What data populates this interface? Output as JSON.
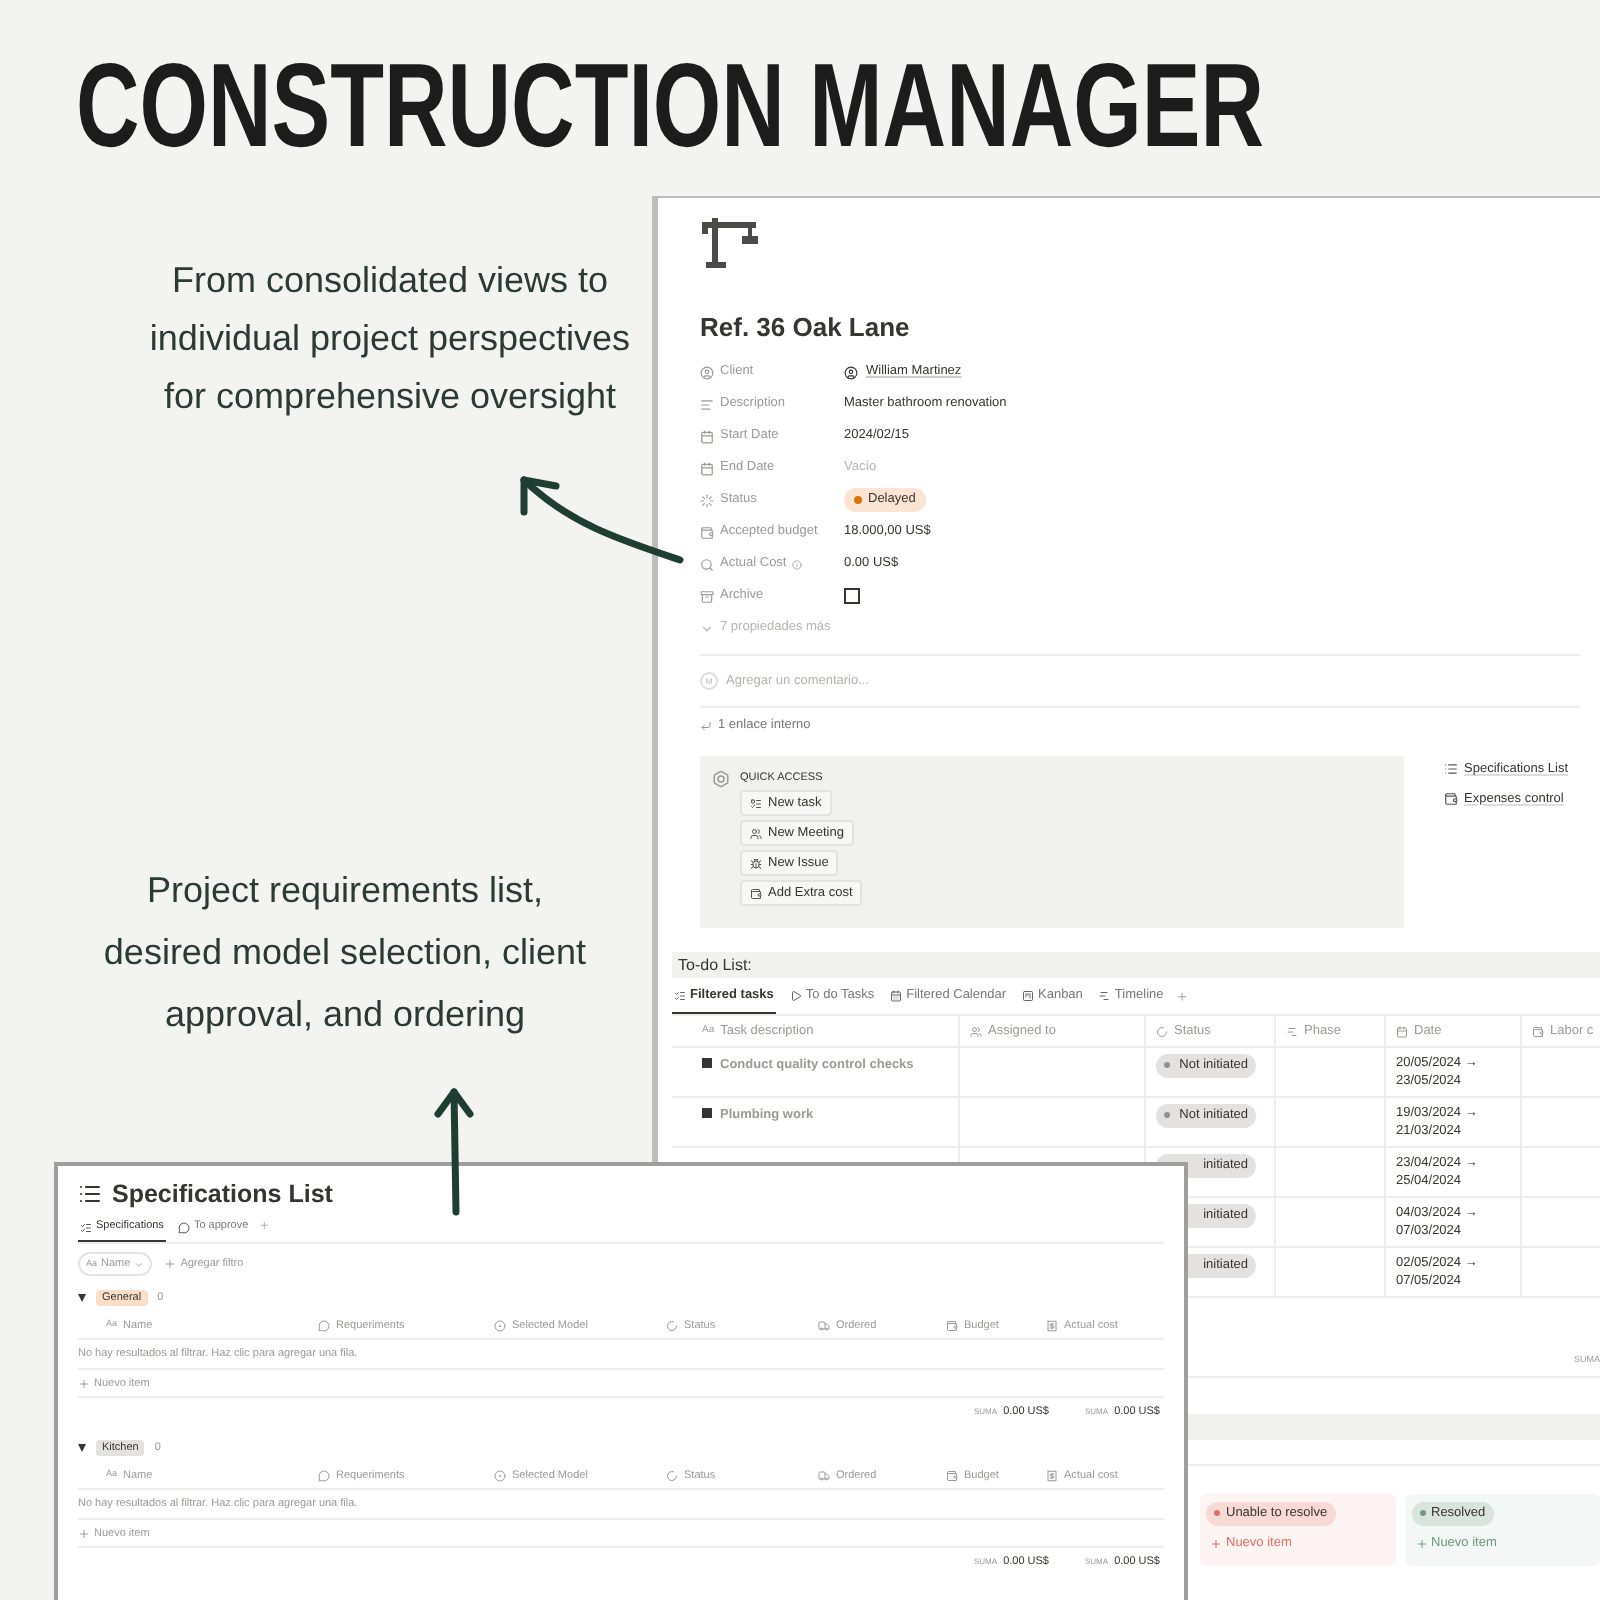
{
  "headline": "CONSTRUCTION MANAGER",
  "captions": [
    {
      "lines": [
        "From consolidated views to",
        "individual project perspectives",
        "for comprehensive oversight"
      ]
    },
    {
      "lines": [
        "Project requirements list,",
        "desired model selection, client",
        "approval, and ordering"
      ]
    }
  ],
  "project_page": {
    "title": "Ref. 36 Oak Lane",
    "properties": [
      {
        "label": "Client",
        "kind": "person",
        "value": "William Martinez"
      },
      {
        "label": "Description",
        "kind": "text",
        "value": "Master bathroom renovation"
      },
      {
        "label": "Start Date",
        "kind": "text",
        "value": "2024/02/15"
      },
      {
        "label": "End Date",
        "kind": "empty",
        "value": "Vacío"
      },
      {
        "label": "Status",
        "kind": "status",
        "value": "Delayed",
        "color": "#d9730d"
      },
      {
        "label": "Accepted budget",
        "kind": "text",
        "value": "18.000,00 US$"
      },
      {
        "label": "Actual Cost",
        "kind": "text",
        "value": "0.00 US$",
        "info": true
      },
      {
        "label": "Archive",
        "kind": "checkbox",
        "checked": false
      }
    ],
    "more_properties": "7 propiedades más",
    "comment_placeholder": "Agregar un comentario...",
    "comment_avatar": "M",
    "backlinks": "1 enlace interno",
    "quick_access": {
      "title": "QUICK ACCESS",
      "buttons": [
        "New task",
        "New Meeting",
        "New Issue",
        "Add Extra cost"
      ]
    },
    "links": [
      "Specifications List",
      "Expenses control"
    ],
    "todo": {
      "title": "To-do List:",
      "tabs": [
        {
          "label": "Filtered tasks",
          "selected": true
        },
        {
          "label": "To do Tasks",
          "selected": false
        },
        {
          "label": "Filtered Calendar",
          "selected": false
        },
        {
          "label": "Kanban",
          "selected": false
        },
        {
          "label": "Timeline",
          "selected": false
        }
      ],
      "add_tab": "+",
      "title_marker": "Aa",
      "columns": [
        "Task description",
        "Assigned to",
        "Status",
        "Phase",
        "Date",
        "Labor c"
      ],
      "rows": [
        {
          "task": "Conduct quality control checks",
          "status": "Not initiated",
          "date": [
            "20/05/2024 →",
            "23/05/2024"
          ]
        },
        {
          "task": "Plumbing work",
          "status": "Not initiated",
          "date": [
            "19/03/2024 →",
            "21/03/2024"
          ]
        },
        {
          "status": "initiated",
          "date": [
            "23/04/2024 →",
            "25/04/2024"
          ]
        },
        {
          "status": "initiated",
          "date": [
            "04/03/2024 →",
            "07/03/2024"
          ]
        },
        {
          "status": "initiated",
          "date": [
            "02/05/2024 →",
            "07/05/2024"
          ]
        }
      ],
      "sum_label": "SUMA"
    },
    "kanban": [
      {
        "label": "Unable to resolve",
        "color": "#e16f64",
        "add": "Nuevo item"
      },
      {
        "label": "Resolved",
        "color": "#6c9b7d",
        "add": "Nuevo item"
      }
    ]
  },
  "specifications_window": {
    "title": "Specifications List",
    "tabs": [
      {
        "label": "Specifications",
        "selected": true
      },
      {
        "label": "To approve",
        "selected": false
      }
    ],
    "add_tab": "+",
    "filter_marker": "Aa",
    "filter_chip": "Name",
    "add_filter": "Agregar filtro",
    "groups": [
      {
        "label": "General",
        "color": "#fadec9",
        "count": "0",
        "title_marker": "Aa",
        "columns": [
          "Name",
          "Requeriments",
          "Selected Model",
          "Status",
          "Ordered",
          "Budget",
          "Actual cost"
        ],
        "empty": "No hay resultados al filtrar. Haz clic para agregar una fila.",
        "add": "Nuevo item",
        "sums": [
          {
            "label": "SUMA",
            "value": "0.00 US$"
          },
          {
            "label": "SUMA",
            "value": "0.00 US$"
          }
        ]
      },
      {
        "label": "Kitchen",
        "color": "#e3e2e0",
        "count": "0",
        "title_marker": "Aa",
        "columns": [
          "Name",
          "Requeriments",
          "Selected Model",
          "Status",
          "Ordered",
          "Budget",
          "Actual cost"
        ],
        "empty": "No hay resultados al filtrar. Haz clic para agregar una fila.",
        "add": "Nuevo item",
        "sums": [
          {
            "label": "SUMA",
            "value": "0.00 US$"
          },
          {
            "label": "SUMA",
            "value": "0.00 US$"
          }
        ]
      }
    ]
  }
}
